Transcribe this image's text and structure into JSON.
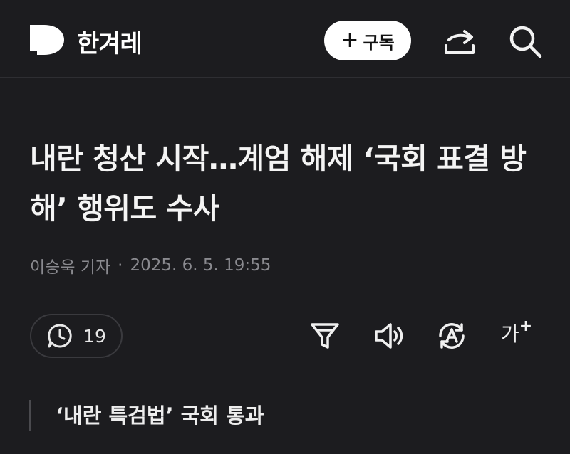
{
  "header": {
    "brand": "한겨레",
    "subscribe_label": "구독",
    "subscribe_icon": "plus-icon"
  },
  "article": {
    "headline": "내란 청산 시작…계엄 해제 ‘국회 표결 방해’ 행위도 수사",
    "author": "이승욱 기자",
    "separator": "·",
    "datetime": "2025. 6. 5. 19:55",
    "comment_count": "19",
    "font_size_label": "가"
  },
  "related": {
    "title": "‘내란 특검법’ 국회 통과"
  },
  "colors": {
    "background": "#1c1c1f",
    "text": "#f2f2f2",
    "muted": "#8a8a8f",
    "subscribe_bg": "#ffffff"
  }
}
